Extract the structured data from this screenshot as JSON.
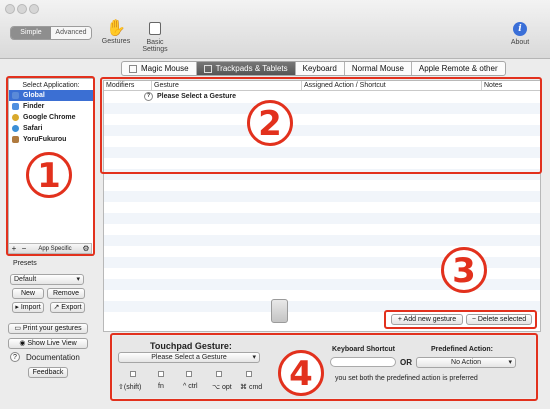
{
  "window": {
    "mode_simple": "Simple",
    "mode_advanced": "Advanced",
    "toolbar": {
      "gestures_label": "Gestures",
      "basic_settings_label": "Basic Settings",
      "about_label": "About"
    }
  },
  "tabs": [
    "Magic Mouse",
    "Trackpads & Tablets",
    "Keyboard",
    "Normal Mouse",
    "Apple Remote & other"
  ],
  "active_tab": "Trackpads & Tablets",
  "sidebar": {
    "header": "Select Application:",
    "apps": [
      {
        "label": "Global",
        "icon": "global-icon",
        "color": "#5b8ad8"
      },
      {
        "label": "Finder",
        "icon": "finder-icon",
        "color": "#4f8fe0"
      },
      {
        "label": "Google Chrome",
        "icon": "chrome-icon",
        "color": "#d9a92b"
      },
      {
        "label": "Safari",
        "icon": "safari-icon",
        "color": "#3c8fd6"
      },
      {
        "label": "YoruFukurou",
        "icon": "owl-icon",
        "color": "#b07a3e"
      }
    ],
    "add": "+",
    "remove": "−",
    "app_specific": "App Specific",
    "presets_label": "Presets",
    "preset_value": "Default",
    "new_label": "New",
    "remove_label": "Remove",
    "import_label": "Import",
    "export_label": "Export",
    "print_label": "Print your gestures",
    "live_view_label": "Show Live View",
    "documentation_label": "Documentation",
    "feedback_label": "Feedback"
  },
  "table": {
    "columns": [
      "Modifiers",
      "Gesture",
      "Assigned Action / Shortcut",
      "Notes"
    ],
    "rows": [
      {
        "modifiers": "",
        "gesture": "Please Select a Gesture",
        "action": "",
        "notes": ""
      }
    ],
    "add_label": "+ Add new gesture",
    "delete_label": "− Delete selected"
  },
  "gesture_editor": {
    "touchpad_label": "Touchpad Gesture:",
    "gesture_select": "Please Select a Gesture",
    "keyboard_shortcut_label": "Keyboard Shortcut",
    "or_label": "OR",
    "predefined_label": "Predefined Action:",
    "predefined_value": "No Action",
    "modifiers": [
      "⇧(shift)",
      "fn",
      "^ ctrl",
      "⌥ opt",
      "⌘ cmd"
    ],
    "note": "you set both the predefined action is preferred"
  },
  "annotations": [
    "1",
    "2",
    "3",
    "4"
  ],
  "colors": {
    "annotation": "#e2311d",
    "selection": "#3b6fd3"
  }
}
